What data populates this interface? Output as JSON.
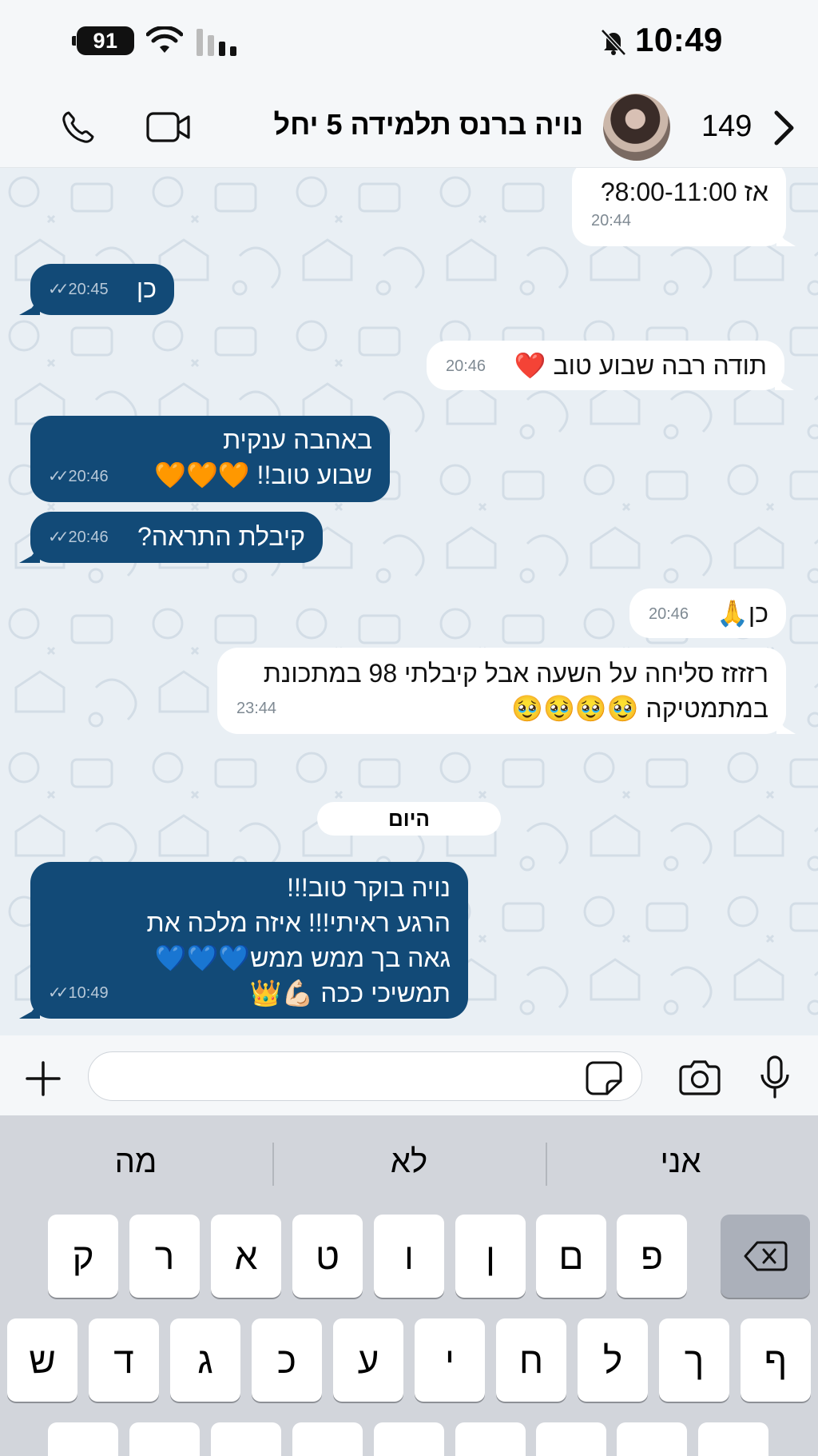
{
  "status_bar": {
    "battery": "91",
    "time": "10:49"
  },
  "header": {
    "title": "נויה ברנס תלמידה 5 יחל",
    "unread_count": "149"
  },
  "messages": [
    {
      "direction": "in",
      "text": "אז 8:00-11:00?",
      "time": "20:44"
    },
    {
      "direction": "out",
      "text": "כן",
      "time": "20:45"
    },
    {
      "direction": "in",
      "text": "תודה רבה שבוע טוב ❤️",
      "time": "20:46"
    },
    {
      "direction": "out",
      "text": "באהבה ענקית\nשבוע טוב!! 🧡🧡🧡",
      "time": "20:46"
    },
    {
      "direction": "out",
      "text": "קיבלת התראה?",
      "time": "20:46"
    },
    {
      "direction": "in",
      "text": "כן🙏",
      "time": "20:46"
    },
    {
      "direction": "in",
      "text": "רזזזז סליחה על השעה אבל קיבלתי 98 במתכונת\nבמתמטיקה 🥹🥹🥹🥹",
      "time": "23:44"
    },
    {
      "direction": "out",
      "text": "נויה בוקר טוב!!!\nהרגע ראיתי!!! איזה מלכה את\nגאה בך ממש ממש💙💙💙\nתמשיכי ככה 💪🏻👑",
      "time": "10:49"
    }
  ],
  "day_separator": "היום",
  "composer": {
    "placeholder": ""
  },
  "keyboard": {
    "suggestions": [
      "אני",
      "לא",
      "מה"
    ],
    "row1": [
      "פ",
      "ם",
      "ן",
      "ו",
      "ט",
      "א",
      "ר",
      "ק"
    ],
    "row2": [
      "ף",
      "ך",
      "ל",
      "ח",
      "י",
      "ע",
      "כ",
      "ג",
      "ד",
      "ש"
    ]
  },
  "colors": {
    "outgoing_bubble": "#124a77",
    "incoming_bubble": "#ffffff",
    "chat_background": "#e9eff4"
  },
  "icons": [
    "phone-icon",
    "video-icon",
    "chevron-right-icon",
    "plus-icon",
    "sticker-icon",
    "camera-icon",
    "microphone-icon",
    "backspace-icon",
    "wifi-icon",
    "cellular-icon",
    "bell-off-icon"
  ]
}
